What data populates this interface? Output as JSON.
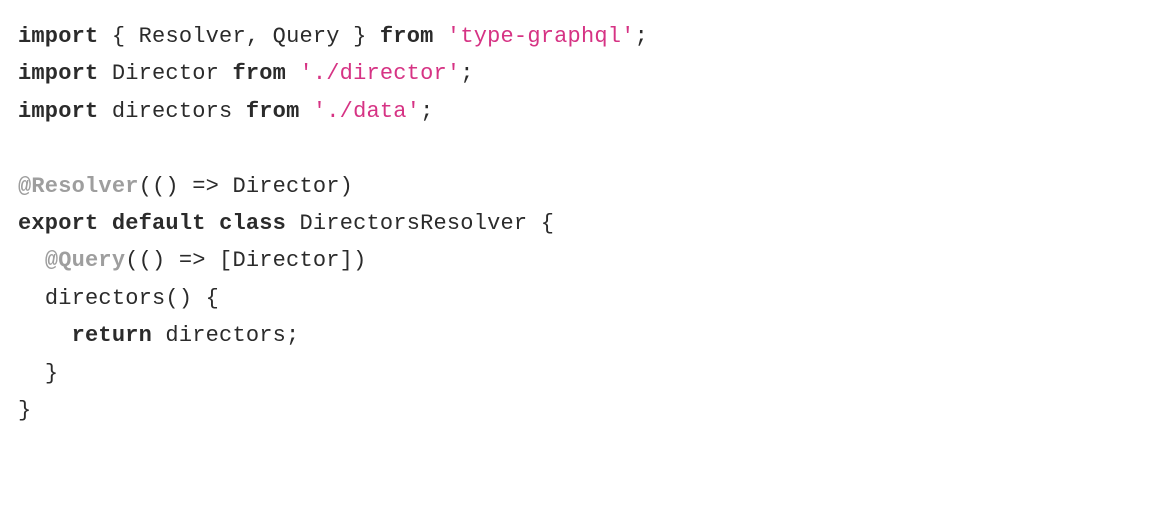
{
  "code": {
    "line1": {
      "kw_import": "import",
      "brace_open": " { ",
      "resolver": "Resolver",
      "comma": ", ",
      "query": "Query",
      "brace_close": " } ",
      "kw_from": "from",
      "space": " ",
      "str": "'type-graphql'",
      "semi": ";"
    },
    "line2": {
      "kw_import": "import",
      "space1": " ",
      "director": "Director",
      "space2": " ",
      "kw_from": "from",
      "space3": " ",
      "str": "'./director'",
      "semi": ";"
    },
    "line3": {
      "kw_import": "import",
      "space1": " ",
      "directors": "directors",
      "space2": " ",
      "kw_from": "from",
      "space3": " ",
      "str": "'./data'",
      "semi": ";"
    },
    "line5": {
      "dec": "@Resolver",
      "rest": "(() => Director)"
    },
    "line6": {
      "kw_export": "export",
      "space1": " ",
      "kw_default": "default",
      "space2": " ",
      "kw_class": "class",
      "space3": " ",
      "classname": "DirectorsResolver",
      "brace": " {"
    },
    "line7": {
      "indent": "  ",
      "dec": "@Query",
      "rest": "(() => [Director])"
    },
    "line8": {
      "indent": "  ",
      "text": "directors() {"
    },
    "line9": {
      "indent": "    ",
      "kw_return": "return",
      "rest": " directors;"
    },
    "line10": {
      "indent": "  ",
      "text": "}"
    },
    "line11": {
      "text": "}"
    }
  }
}
